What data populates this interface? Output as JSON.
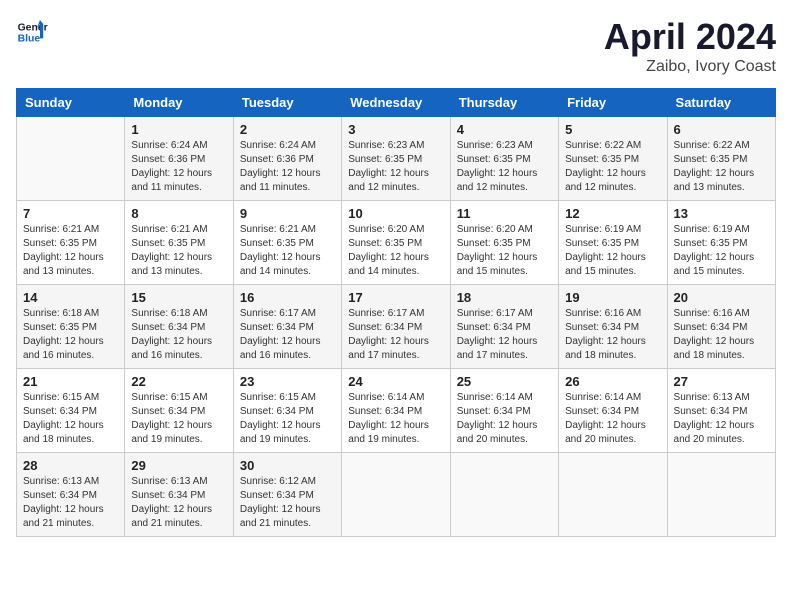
{
  "header": {
    "logo_general": "General",
    "logo_blue": "Blue",
    "month_title": "April 2024",
    "location": "Zaibo, Ivory Coast"
  },
  "days_of_week": [
    "Sunday",
    "Monday",
    "Tuesday",
    "Wednesday",
    "Thursday",
    "Friday",
    "Saturday"
  ],
  "weeks": [
    [
      {
        "day": "",
        "info": ""
      },
      {
        "day": "1",
        "info": "Sunrise: 6:24 AM\nSunset: 6:36 PM\nDaylight: 12 hours and 11 minutes."
      },
      {
        "day": "2",
        "info": "Sunrise: 6:24 AM\nSunset: 6:36 PM\nDaylight: 12 hours and 11 minutes."
      },
      {
        "day": "3",
        "info": "Sunrise: 6:23 AM\nSunset: 6:35 PM\nDaylight: 12 hours and 12 minutes."
      },
      {
        "day": "4",
        "info": "Sunrise: 6:23 AM\nSunset: 6:35 PM\nDaylight: 12 hours and 12 minutes."
      },
      {
        "day": "5",
        "info": "Sunrise: 6:22 AM\nSunset: 6:35 PM\nDaylight: 12 hours and 12 minutes."
      },
      {
        "day": "6",
        "info": "Sunrise: 6:22 AM\nSunset: 6:35 PM\nDaylight: 12 hours and 13 minutes."
      }
    ],
    [
      {
        "day": "7",
        "info": "Sunrise: 6:21 AM\nSunset: 6:35 PM\nDaylight: 12 hours and 13 minutes."
      },
      {
        "day": "8",
        "info": "Sunrise: 6:21 AM\nSunset: 6:35 PM\nDaylight: 12 hours and 13 minutes."
      },
      {
        "day": "9",
        "info": "Sunrise: 6:21 AM\nSunset: 6:35 PM\nDaylight: 12 hours and 14 minutes."
      },
      {
        "day": "10",
        "info": "Sunrise: 6:20 AM\nSunset: 6:35 PM\nDaylight: 12 hours and 14 minutes."
      },
      {
        "day": "11",
        "info": "Sunrise: 6:20 AM\nSunset: 6:35 PM\nDaylight: 12 hours and 15 minutes."
      },
      {
        "day": "12",
        "info": "Sunrise: 6:19 AM\nSunset: 6:35 PM\nDaylight: 12 hours and 15 minutes."
      },
      {
        "day": "13",
        "info": "Sunrise: 6:19 AM\nSunset: 6:35 PM\nDaylight: 12 hours and 15 minutes."
      }
    ],
    [
      {
        "day": "14",
        "info": "Sunrise: 6:18 AM\nSunset: 6:35 PM\nDaylight: 12 hours and 16 minutes."
      },
      {
        "day": "15",
        "info": "Sunrise: 6:18 AM\nSunset: 6:34 PM\nDaylight: 12 hours and 16 minutes."
      },
      {
        "day": "16",
        "info": "Sunrise: 6:17 AM\nSunset: 6:34 PM\nDaylight: 12 hours and 16 minutes."
      },
      {
        "day": "17",
        "info": "Sunrise: 6:17 AM\nSunset: 6:34 PM\nDaylight: 12 hours and 17 minutes."
      },
      {
        "day": "18",
        "info": "Sunrise: 6:17 AM\nSunset: 6:34 PM\nDaylight: 12 hours and 17 minutes."
      },
      {
        "day": "19",
        "info": "Sunrise: 6:16 AM\nSunset: 6:34 PM\nDaylight: 12 hours and 18 minutes."
      },
      {
        "day": "20",
        "info": "Sunrise: 6:16 AM\nSunset: 6:34 PM\nDaylight: 12 hours and 18 minutes."
      }
    ],
    [
      {
        "day": "21",
        "info": "Sunrise: 6:15 AM\nSunset: 6:34 PM\nDaylight: 12 hours and 18 minutes."
      },
      {
        "day": "22",
        "info": "Sunrise: 6:15 AM\nSunset: 6:34 PM\nDaylight: 12 hours and 19 minutes."
      },
      {
        "day": "23",
        "info": "Sunrise: 6:15 AM\nSunset: 6:34 PM\nDaylight: 12 hours and 19 minutes."
      },
      {
        "day": "24",
        "info": "Sunrise: 6:14 AM\nSunset: 6:34 PM\nDaylight: 12 hours and 19 minutes."
      },
      {
        "day": "25",
        "info": "Sunrise: 6:14 AM\nSunset: 6:34 PM\nDaylight: 12 hours and 20 minutes."
      },
      {
        "day": "26",
        "info": "Sunrise: 6:14 AM\nSunset: 6:34 PM\nDaylight: 12 hours and 20 minutes."
      },
      {
        "day": "27",
        "info": "Sunrise: 6:13 AM\nSunset: 6:34 PM\nDaylight: 12 hours and 20 minutes."
      }
    ],
    [
      {
        "day": "28",
        "info": "Sunrise: 6:13 AM\nSunset: 6:34 PM\nDaylight: 12 hours and 21 minutes."
      },
      {
        "day": "29",
        "info": "Sunrise: 6:13 AM\nSunset: 6:34 PM\nDaylight: 12 hours and 21 minutes."
      },
      {
        "day": "30",
        "info": "Sunrise: 6:12 AM\nSunset: 6:34 PM\nDaylight: 12 hours and 21 minutes."
      },
      {
        "day": "",
        "info": ""
      },
      {
        "day": "",
        "info": ""
      },
      {
        "day": "",
        "info": ""
      },
      {
        "day": "",
        "info": ""
      }
    ]
  ]
}
